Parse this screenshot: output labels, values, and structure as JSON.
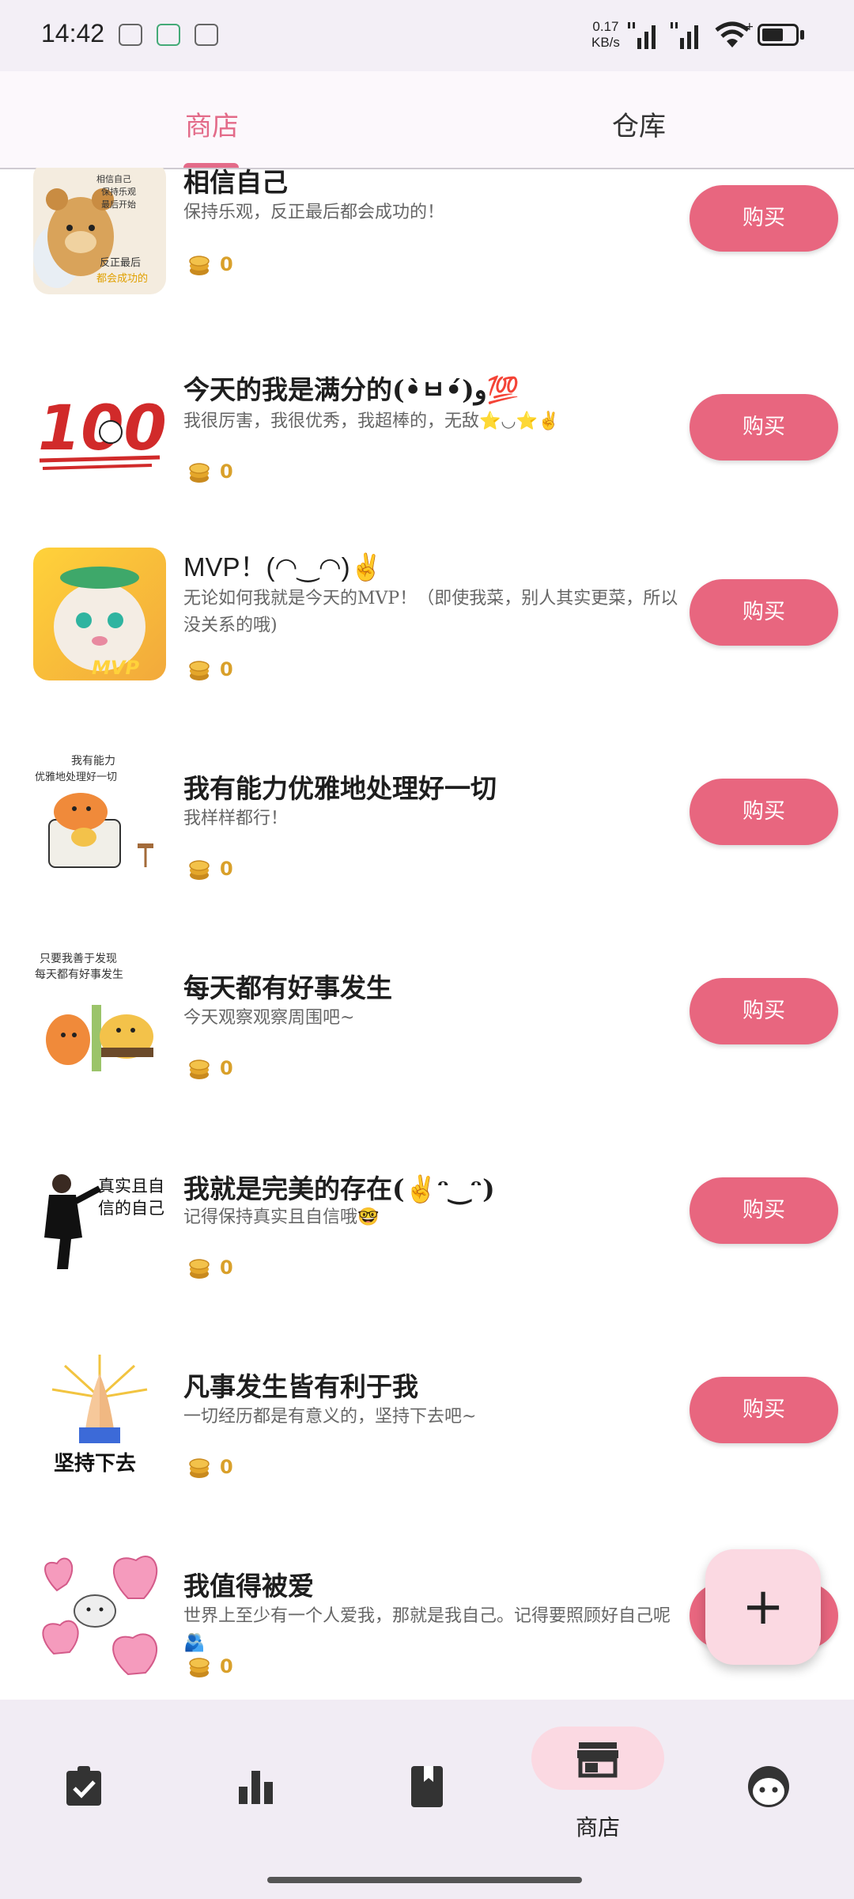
{
  "status_bar": {
    "time": "14:42",
    "speed_value": "0.17",
    "speed_unit": "KB/s",
    "battery": "51",
    "icons": [
      "vr-icon",
      "gallery-icon",
      "app-notification-icon",
      "signal-icon",
      "signal-icon",
      "wifi-icon",
      "battery-icon"
    ]
  },
  "tabs": {
    "store": "商店",
    "warehouse": "仓库",
    "active": "store",
    "accent_color": "#e36b89"
  },
  "items": [
    {
      "title": "相信自己",
      "desc": "保持乐观，反正最后都会成功的！",
      "price": "0",
      "buy": "购买",
      "thumb": "bear-sticker"
    },
    {
      "title": "今天的我是满分的(•̀ㅂ•́)و💯",
      "desc": "我很厉害，我很优秀，我超棒的，无敌⭐◡⭐✌",
      "price": "0",
      "buy": "购买",
      "thumb": "100-sticker"
    },
    {
      "title": "MVP！(◠‿◠)✌",
      "desc": "无论如何我就是今天的MVP！（即使我菜，别人其实更菜，所以没关系的哦)",
      "price": "0",
      "buy": "购买",
      "thumb": "mvp-hamster-sticker"
    },
    {
      "title": "我有能力优雅地处理好一切",
      "desc": "我样样都行！",
      "price": "0",
      "buy": "购买",
      "thumb": "elegant-sticker"
    },
    {
      "title": "每天都有好事发生",
      "desc": "今天观察观察周围吧~",
      "price": "0",
      "buy": "购买",
      "thumb": "good-things-sticker"
    },
    {
      "title": "我就是完美的存在(✌ᵔ‿ᵔ)",
      "desc": "记得保持真实且自信哦🤓",
      "price": "0",
      "buy": "购买",
      "thumb": "real-self-sticker"
    },
    {
      "title": "凡事发生皆有利于我",
      "desc": "一切经历都是有意义的，坚持下去吧~",
      "price": "0",
      "buy": "购买",
      "thumb": "praying-hands-sticker"
    },
    {
      "title": "我值得被爱",
      "desc": "世界上至少有一个人爱我，那就是我自己。记得要照顾好自己呢🫂",
      "price": "0",
      "buy": "购买",
      "thumb": "hearts-sticker"
    }
  ],
  "stickers": {
    "bear_lines": [
      "相信自己",
      "保持乐观",
      "最后开始",
      "反正最后",
      "都会成功的"
    ],
    "hundred": "100",
    "mvp": "MVP",
    "elegant_lines": [
      "我有能力",
      "优雅地处理好一切"
    ],
    "good_lines": [
      "只要我善于发现",
      "每天都有好事发生"
    ],
    "real_lines": [
      "真实且自",
      "信的自己"
    ],
    "praying_caption": "坚持下去"
  },
  "fab": {
    "symbol": "+"
  },
  "bottom_nav": {
    "items": [
      "tasks-icon",
      "stats-icon",
      "book-icon",
      "store-icon",
      "profile-icon"
    ],
    "active_label": "商店",
    "active_index": 3
  },
  "colors": {
    "buy_button": "#e8667f",
    "coin": "#d9a02a",
    "fab_bg": "#fbd9e2",
    "nav_bg": "#f1ecf4"
  }
}
